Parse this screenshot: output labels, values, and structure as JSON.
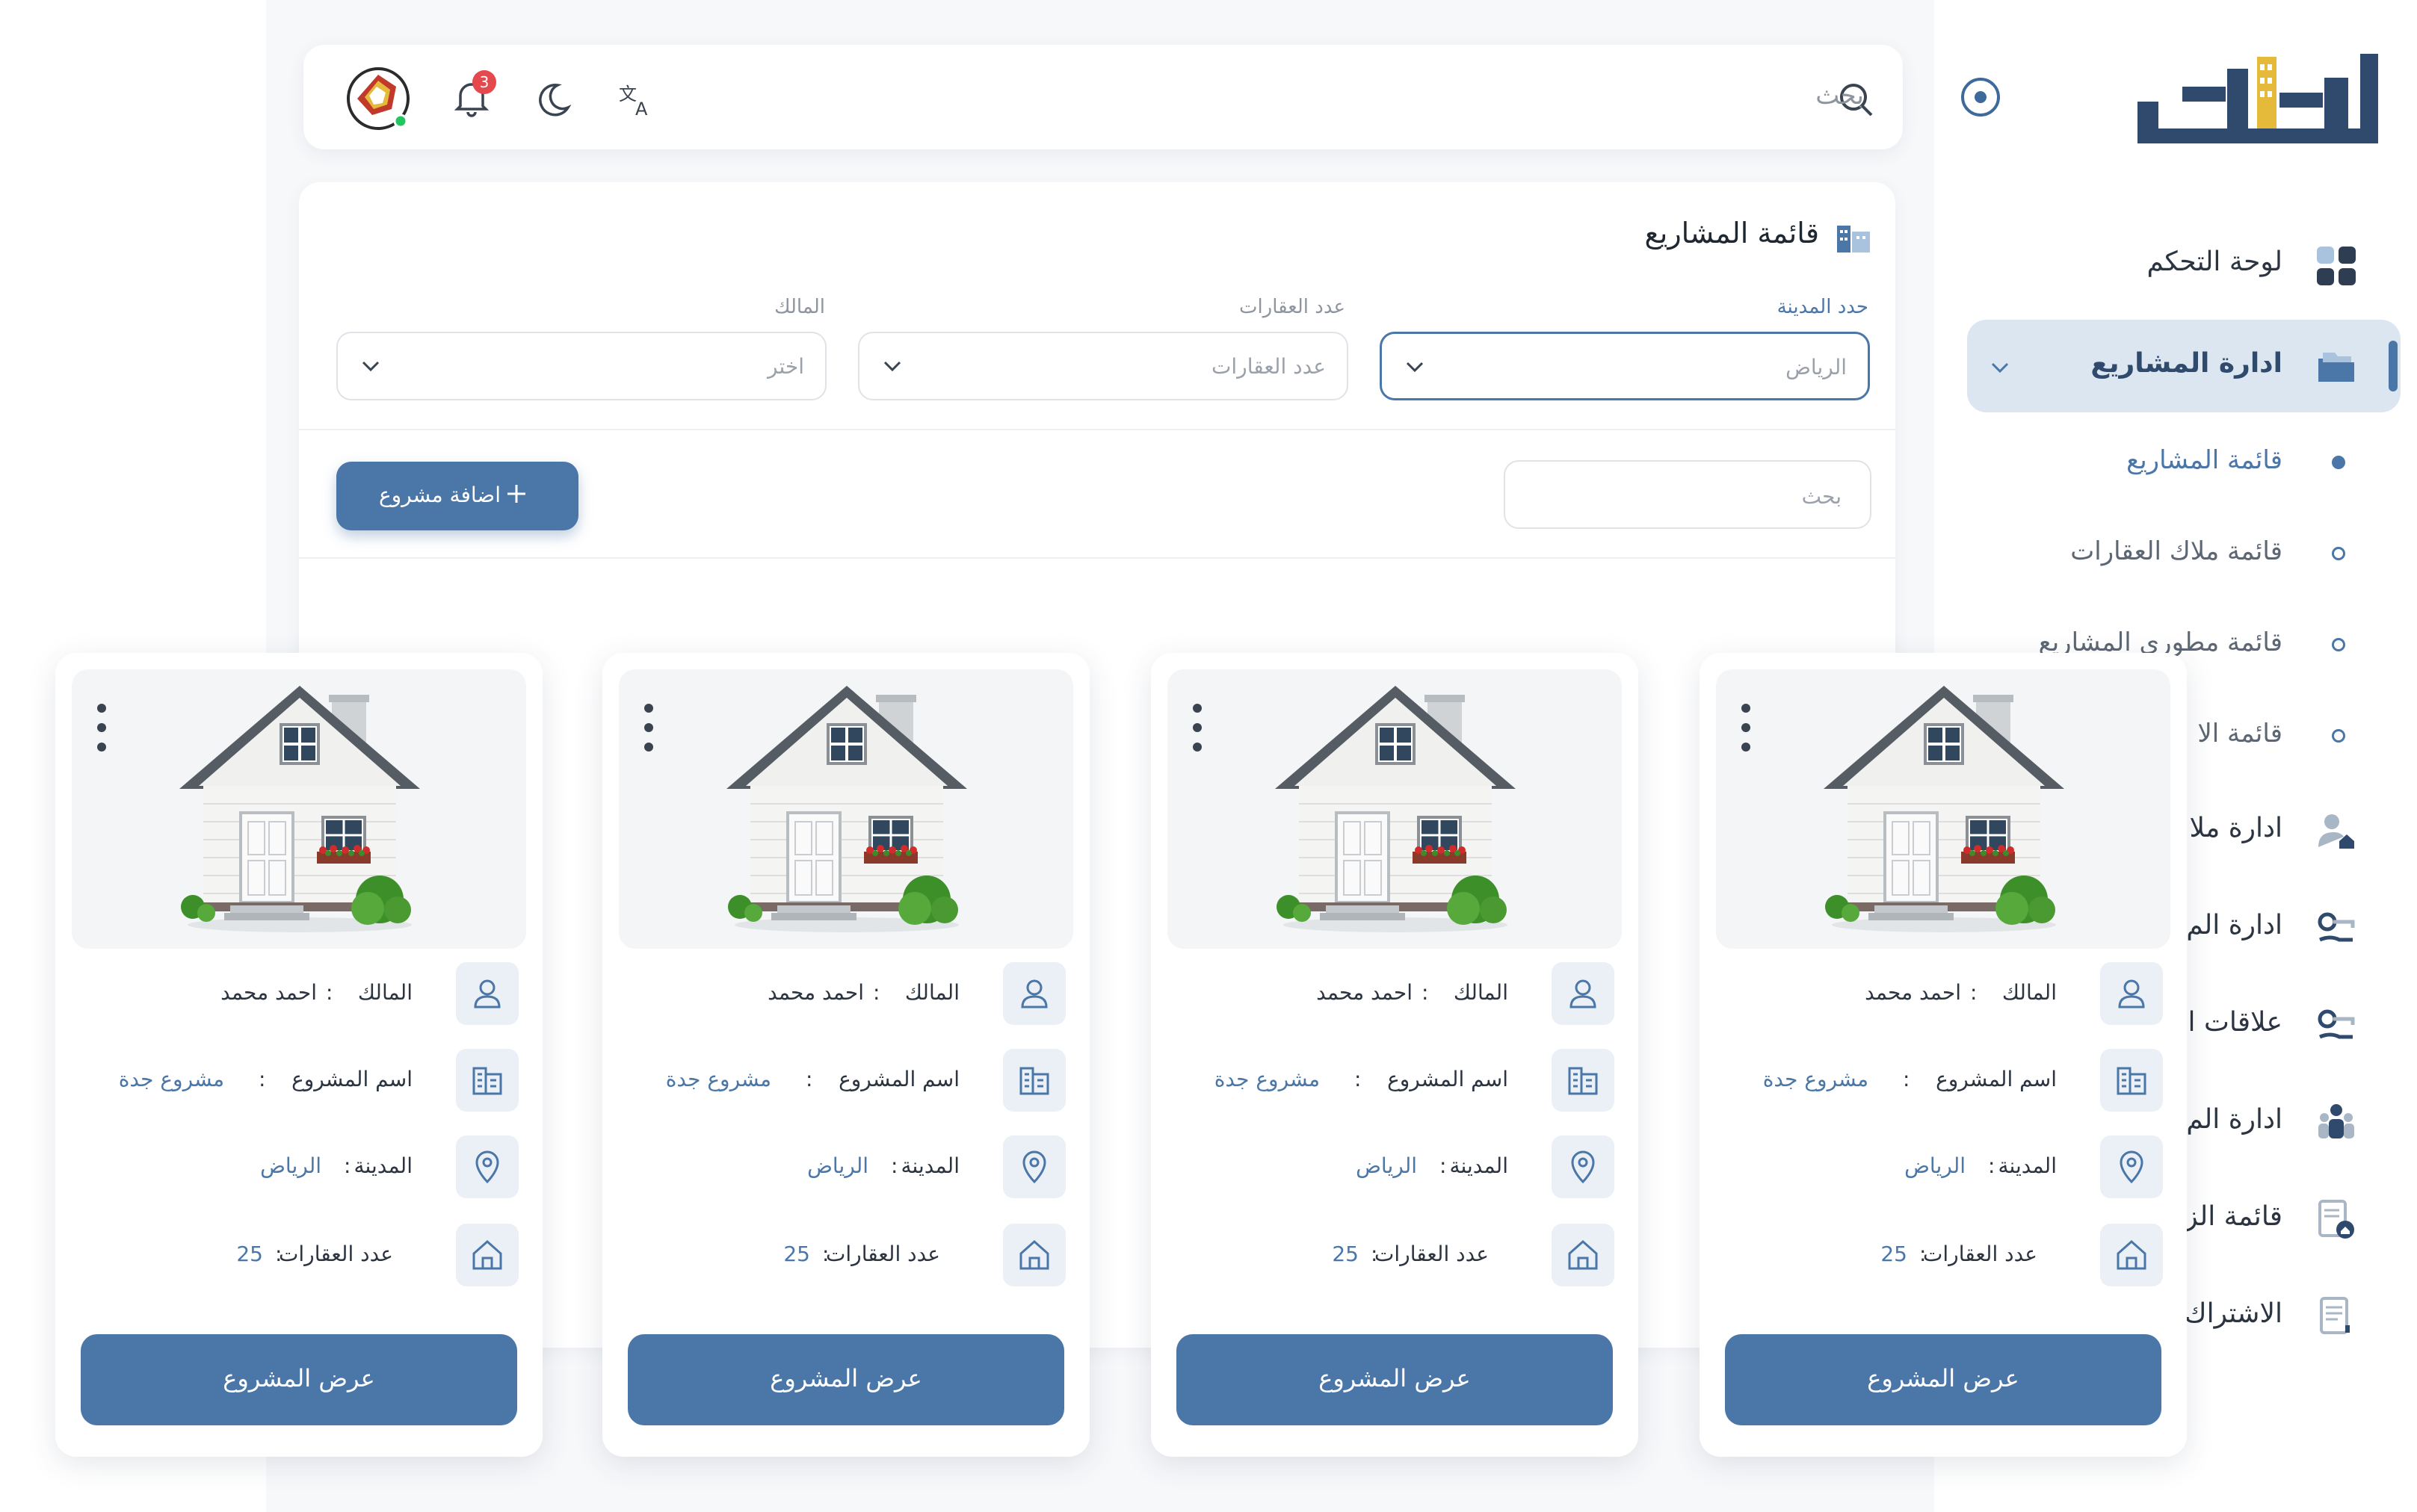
{
  "brand": {
    "logo_text": "املاك",
    "accent": "#4a76a8",
    "logo_accent": "#e5b93a",
    "logo_dark": "#2f4a6c"
  },
  "topbar": {
    "search_label": "بحث",
    "notification_count": "3",
    "icons": [
      "search-icon",
      "translate-icon",
      "moon-icon",
      "bell-icon",
      "avatar"
    ]
  },
  "sidebar": {
    "dashboard": "لوحة التحكم",
    "projects_admin": "ادارة المشاريع",
    "sub_items": [
      "قائمة المشاريع",
      "قائمة ملاك العقارات",
      "قائمة مطوري المشاريع",
      "قائمة الا"
    ],
    "items": [
      "ادارة ملا",
      "ادارة الم",
      "علاقات ا",
      "ادارة الم",
      "قائمة الز",
      "الاشتراك"
    ]
  },
  "panel": {
    "title": "قائمة المشاريع",
    "filters": [
      {
        "label": "حدد المدينة",
        "value": "الرياض"
      },
      {
        "label": "عدد العقارات",
        "value": "عدد العقارات"
      },
      {
        "label": "المالك",
        "value": "اختر"
      }
    ],
    "search_placeholder": "بحث",
    "add_button": "اضافة مشروع"
  },
  "cards": [
    {
      "owner_label": "المالك",
      "owner": "احمد محمد",
      "project_label": "اسم المشروع",
      "project": "مشروع جدة",
      "city_label": "المدينة",
      "city": "الرياض",
      "count_label": "عدد العقارات",
      "count": "25",
      "button": "عرض المشروع"
    },
    {
      "owner_label": "المالك",
      "owner": "احمد محمد",
      "project_label": "اسم المشروع",
      "project": "مشروع جدة",
      "city_label": "المدينة",
      "city": "الرياض",
      "count_label": "عدد العقارات",
      "count": "25",
      "button": "عرض المشروع"
    },
    {
      "owner_label": "المالك",
      "owner": "احمد محمد",
      "project_label": "اسم المشروع",
      "project": "مشروع جدة",
      "city_label": "المدينة",
      "city": "الرياض",
      "count_label": "عدد العقارات",
      "count": "25",
      "button": "عرض المشروع"
    },
    {
      "owner_label": "المالك",
      "owner": "احمد محمد",
      "project_label": "اسم المشروع",
      "project": "مشروع جدة",
      "city_label": "المدينة",
      "city": "الرياض",
      "count_label": "عدد العقارات",
      "count": "25",
      "button": "عرض المشروع"
    }
  ]
}
